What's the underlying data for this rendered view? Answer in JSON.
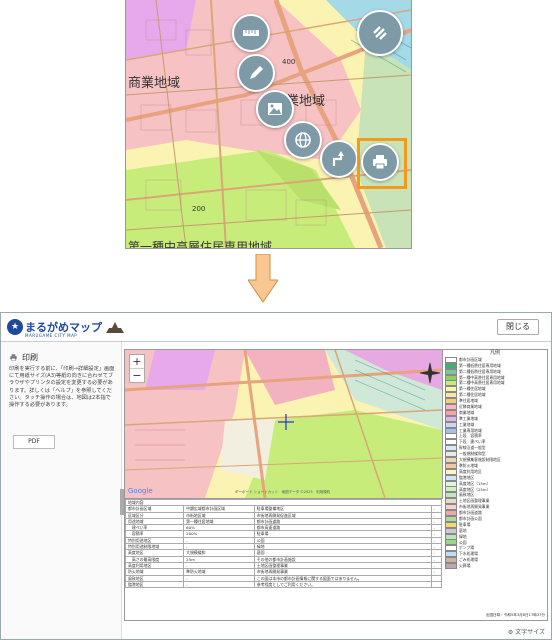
{
  "top_map": {
    "labels": {
      "commercial_zone": "商業地域",
      "commercial_zone_partial": "業地域",
      "bottom_zone": "第一種中高層住居専用地域",
      "number_1": "400",
      "number_2": "200"
    },
    "colors": {
      "commercial": "#f7c2c4",
      "residential_yellow": "#fbf3b2",
      "residential_green": "#c8ec7a",
      "purple": "#e7a9ea",
      "road": "#e7a37e",
      "fab": "#7d9aa6",
      "highlight": "#f39a1c"
    },
    "buttons": [
      "ruler-icon",
      "pencil-icon",
      "image-icon",
      "globe-icon",
      "route-icon",
      "print-icon",
      "menu-icon"
    ]
  },
  "window": {
    "logo_text": "まるがめマップ",
    "logo_sub": "MARUGAME CITY MAP",
    "close_label": "閉じる",
    "print_title": "印刷",
    "print_desc": "印刷を実行する前に、「印刷→詳細設定」画面にて用紙サイズ(A3)等紙の向きに合わせてブラウザやプリンタの設定を変更する必要があります。詳しくは「ヘルプ」を参照してください。タッチ操作の場合は、地図は2本指で操作する必要があります。",
    "pdf_label": "PDF",
    "zoom_in": "+",
    "zoom_out": "−",
    "attribution": "ギーボード ショートカット　地図データ ©2023　利用規約",
    "legend_title": "凡例",
    "legend": [
      {
        "label": "都市計画区域",
        "color": "#ffffff"
      },
      {
        "label": "第一種低層住居専用地域",
        "color": "#3fb06d"
      },
      {
        "label": "第二種低層住居専用地域",
        "color": "#7ac79b"
      },
      {
        "label": "第一種中高層住居専用地域",
        "color": "#8ed160"
      },
      {
        "label": "第二種中高層住居専用地域",
        "color": "#c8ec7a"
      },
      {
        "label": "第一種住居地域",
        "color": "#fbf3b2"
      },
      {
        "label": "第二種住居地域",
        "color": "#f8e7a0"
      },
      {
        "label": "準住居地域",
        "color": "#f4cc7e"
      },
      {
        "label": "近隣商業地域",
        "color": "#f7b7c6"
      },
      {
        "label": "商業地域",
        "color": "#f7a4a8"
      },
      {
        "label": "準工業地域",
        "color": "#d9b7e9"
      },
      {
        "label": "工業地域",
        "color": "#c6d8f2"
      },
      {
        "label": "工業専用地域",
        "color": "#a3c2e8"
      },
      {
        "label": "上段　容積率",
        "color": "#ffffff"
      },
      {
        "label": "下段　建ぺい率",
        "color": "#ffffff"
      },
      {
        "label": "幹線沿道一般型",
        "color": "#dbe8f5"
      },
      {
        "label": "一般規制緩和型",
        "color": "#e8e8e8"
      },
      {
        "label": "大規模集客施設制限地区",
        "color": "#f1d3b3"
      },
      {
        "label": "準防火地域",
        "color": "#f1c8a2"
      },
      {
        "label": "高度利用地区",
        "color": "#fff6c2"
      },
      {
        "label": "臨港地区",
        "color": "#cce6ff"
      },
      {
        "label": "高度地区（15m）",
        "color": "#e3f5d8"
      },
      {
        "label": "高度地区（25m）",
        "color": "#d2eec2"
      },
      {
        "label": "風致地区",
        "color": "#c2e6c2"
      },
      {
        "label": "土地区画整理事業",
        "color": "#ecd9c4"
      },
      {
        "label": "市街地再開発事業",
        "color": "#f5d1d1"
      },
      {
        "label": "都市計画道路",
        "color": "#f3a6a6"
      },
      {
        "label": "都市計画公園",
        "color": "#a6dda6"
      },
      {
        "label": "駐車場",
        "color": "#f7d86a"
      },
      {
        "label": "墓地",
        "color": "#d0c4e0"
      },
      {
        "label": "緑地",
        "color": "#b9e8b0"
      },
      {
        "label": "公園",
        "color": "#9bd48f"
      },
      {
        "label": "ポンプ場",
        "color": "#ffffff"
      },
      {
        "label": "下水処理場",
        "color": "#bfe0f0"
      },
      {
        "label": "ごみ処理場",
        "color": "#c8b79c"
      },
      {
        "label": "火葬場",
        "color": "#bba8a8"
      }
    ],
    "table": {
      "header": "地域内容",
      "rows": [
        [
          "都市計画区域",
          "中讃広域都市計画区域",
          "駐車場整備地区",
          "-"
        ],
        [
          "区域区分",
          "市街地区域",
          "市街地再開発促進区域",
          "-"
        ],
        [
          "用途地域",
          "第一種住居地域",
          "都市計画道路",
          "-"
        ],
        [
          "　建ぺい率",
          "60%",
          "都市高速道路",
          "-"
        ],
        [
          "　容積率",
          "200%",
          "駐車場",
          "-"
        ],
        [
          "特別用途地区",
          "-",
          "公園",
          "-"
        ],
        [
          "特別用途制限地域",
          "-",
          "緑地",
          "-"
        ],
        [
          "高度地区",
          "大規模緩和",
          "墓園",
          "-"
        ],
        [
          "　高さの最高限度",
          "25m",
          "その他の都市計画施設",
          "-"
        ],
        [
          "高度利用地区",
          "-",
          "土地区画整理事業",
          "-"
        ],
        [
          "防火地域",
          "準防火地域",
          "市街地再開発事業",
          "-"
        ],
        [
          "風致地区",
          "-",
          "この図は本市の都市計画情報に関する図面ではありません。",
          ""
        ],
        [
          "臨港地区",
          "-",
          "参考程度としてご利用ください。",
          ""
        ]
      ]
    },
    "footer_note": "出図日時：令和5年3月8日17時37分",
    "text_size_label": "文字サイズ"
  }
}
